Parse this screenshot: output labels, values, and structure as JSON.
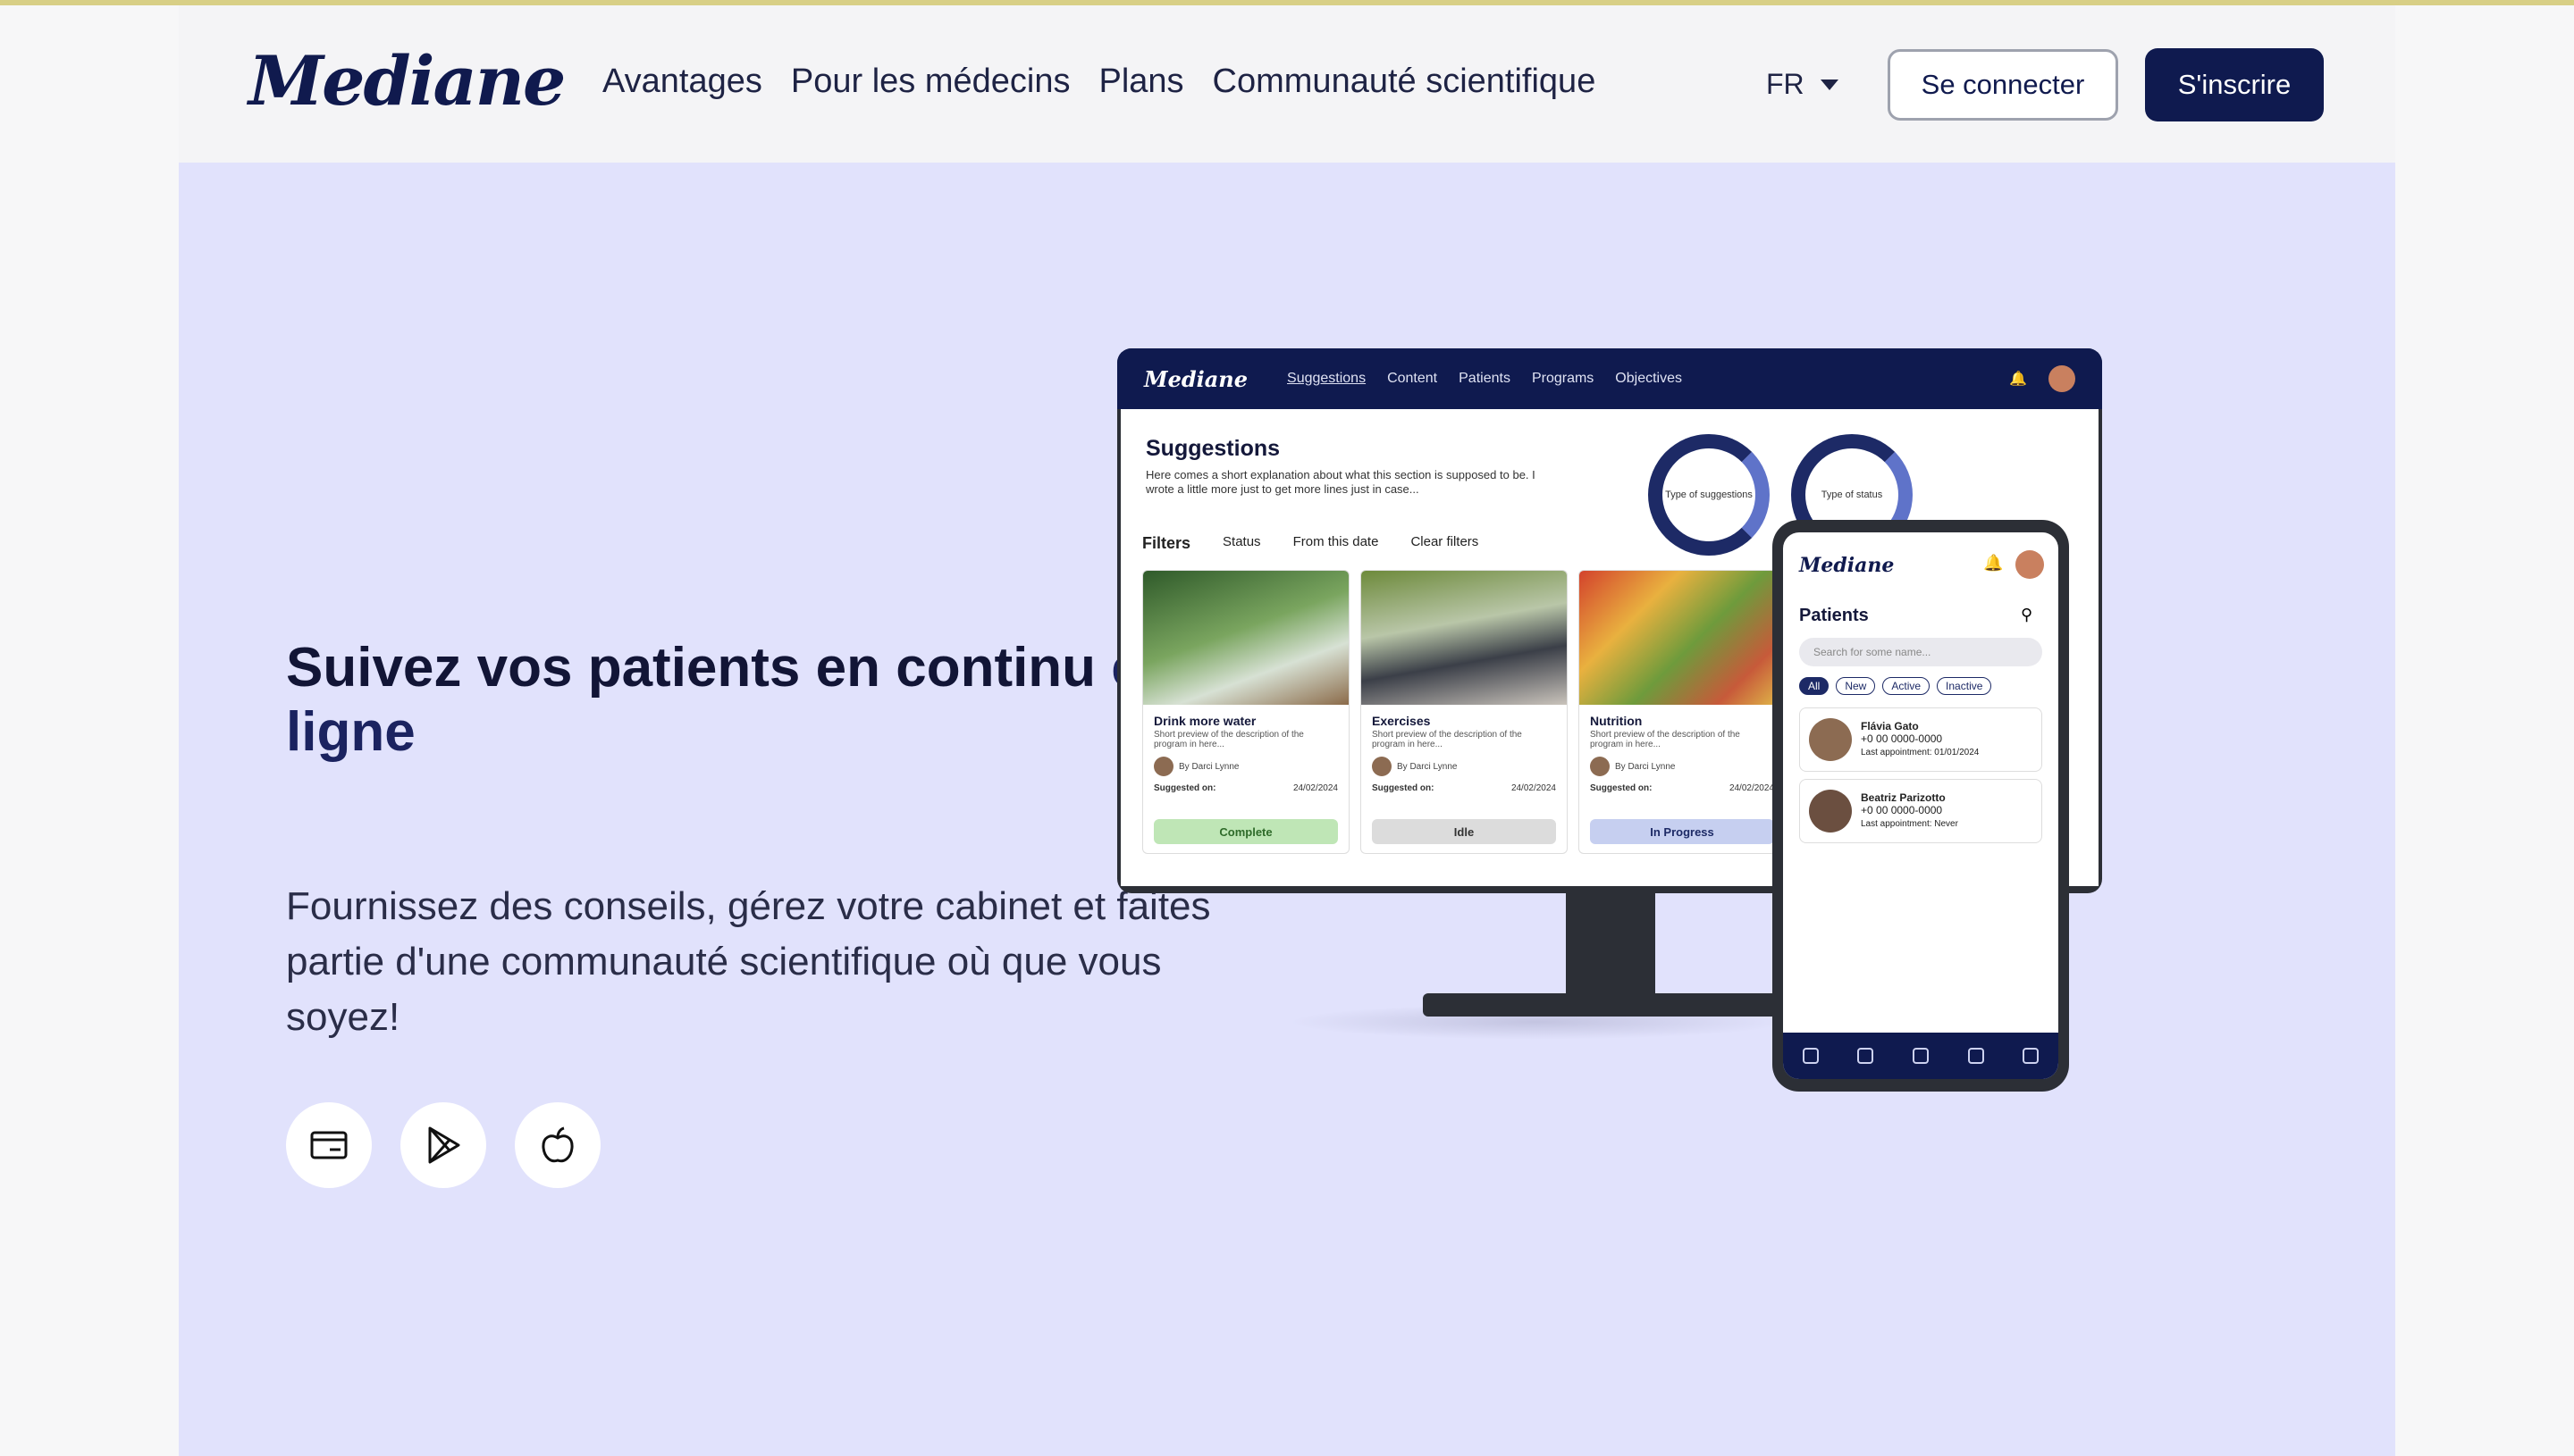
{
  "brand": {
    "logo": "Mediane"
  },
  "nav": [
    {
      "label": "Avantages"
    },
    {
      "label": "Pour les médecins"
    },
    {
      "label": "Plans"
    },
    {
      "label": "Communauté scientifique"
    }
  ],
  "header": {
    "lang": "FR",
    "login_label": "Se connecter",
    "signup_label": "S'inscrire"
  },
  "hero": {
    "title_main": "Suivez vos patients en continu ",
    "title_highlight": "en ligne",
    "description": "Fournissez des conseils, gérez votre cabinet et faites partie d'une communauté scientifique où que vous soyez!",
    "store_icons": [
      "web-app-icon",
      "google-play-icon",
      "apple-icon"
    ]
  },
  "monitor": {
    "logo": "Mediane",
    "nav": [
      "Suggestions",
      "Content",
      "Patients",
      "Programs",
      "Objectives"
    ],
    "title": "Suggestions",
    "description": "Here comes a short explanation about what this section is supposed to be. I wrote a little more just to get more lines just in case...",
    "filters": {
      "label": "Filters",
      "status": "Status",
      "date": "From this date",
      "clear": "Clear filters"
    },
    "donuts": [
      {
        "label": "Type of suggestions"
      },
      {
        "label": "Type of status"
      }
    ],
    "cards": [
      {
        "title": "Drink more water",
        "desc": "Short preview of the description of the program in here...",
        "by": "By Darci Lynne",
        "suggested": "Suggested on:",
        "date": "24/02/2024",
        "status": "Complete"
      },
      {
        "title": "Exercises",
        "desc": "Short preview of the description of the program in here...",
        "by": "By Darci Lynne",
        "suggested": "Suggested on:",
        "date": "24/02/2024",
        "status": "Idle"
      },
      {
        "title": "Nutrition",
        "desc": "Short preview of the description of the program in here...",
        "by": "By Darci Lynne",
        "suggested": "Suggested on:",
        "date": "24/02/2024",
        "status": "In Progress"
      }
    ]
  },
  "phone": {
    "logo": "Mediane",
    "title": "Patients",
    "search_placeholder": "Search for some name...",
    "tabs": [
      "All",
      "New",
      "Active",
      "Inactive"
    ],
    "patients": [
      {
        "name": "Flávia Gato",
        "phone": "+0 00 0000-0000",
        "last": "Last appointment: 01/01/2024"
      },
      {
        "name": "Beatriz Parizotto",
        "phone": "+0 00 0000-0000",
        "last": "Last appointment: Never"
      }
    ]
  },
  "colors": {
    "brand_navy": "#0f1a4f",
    "hero_bg": "#e1e2fc",
    "complete": "#bfe6b6",
    "idle": "#dcdcdc",
    "in_progress": "#c6cff0"
  }
}
